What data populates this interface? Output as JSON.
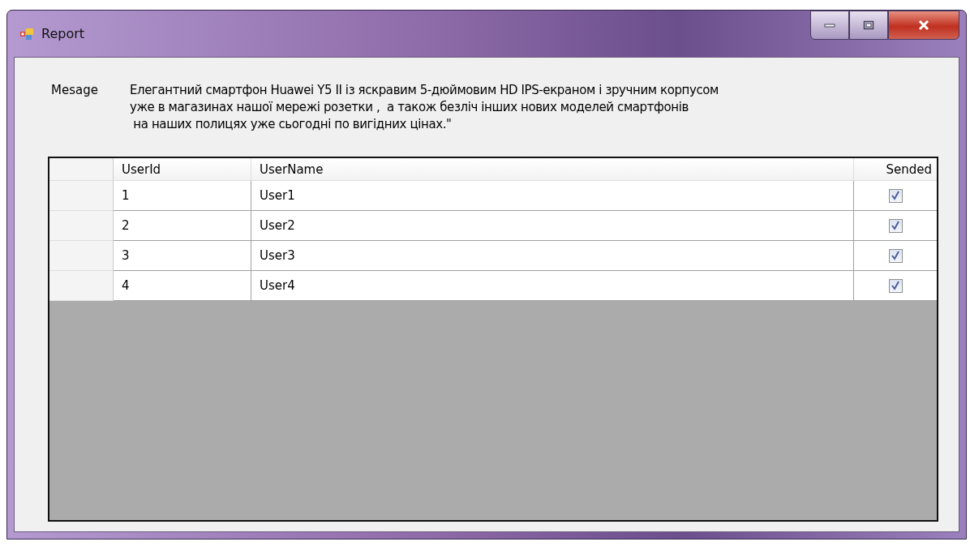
{
  "window": {
    "title": "Report"
  },
  "message": {
    "label": "Mesage",
    "lines": [
      "Елегантний смартфон Huawei Y5 II із яскравим 5-дюймовим HD IPS-екраном і зручним корпусом",
      "уже в магазинах нашої мережі розетки ,  а також безліч інших нових моделей смартфонів",
      " на наших полицях уже сьогодні по вигідних цінах.\""
    ]
  },
  "table": {
    "columns": [
      "UserId",
      "UserName",
      "Sended"
    ],
    "rows": [
      {
        "user_id": "1",
        "user_name": "User1",
        "sended": true
      },
      {
        "user_id": "2",
        "user_name": "User2",
        "sended": true
      },
      {
        "user_id": "3",
        "user_name": "User3",
        "sended": true
      },
      {
        "user_id": "4",
        "user_name": "User4",
        "sended": true
      }
    ]
  }
}
